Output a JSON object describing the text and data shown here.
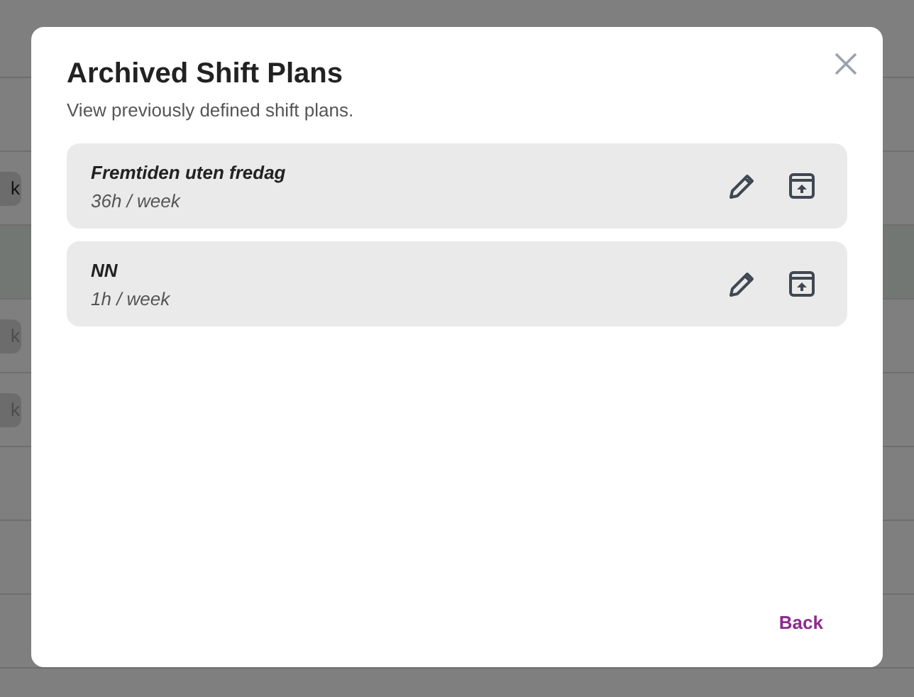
{
  "background": {
    "rows": [
      {
        "kind": "plain"
      },
      {
        "kind": "plain"
      },
      {
        "kind": "chip",
        "label": "k",
        "muted": false
      },
      {
        "kind": "highlight"
      },
      {
        "kind": "chip",
        "label": "k",
        "muted": true
      },
      {
        "kind": "chip",
        "label": "k",
        "muted": true
      },
      {
        "kind": "plain"
      },
      {
        "kind": "plain"
      },
      {
        "kind": "plain"
      }
    ]
  },
  "dialog": {
    "title": "Archived Shift Plans",
    "subtitle": "View previously defined shift plans.",
    "plans": [
      {
        "name": "Fremtiden uten fredag",
        "hours": "36h / week"
      },
      {
        "name": "NN",
        "hours": "1h / week"
      }
    ],
    "back_button": "Back"
  }
}
